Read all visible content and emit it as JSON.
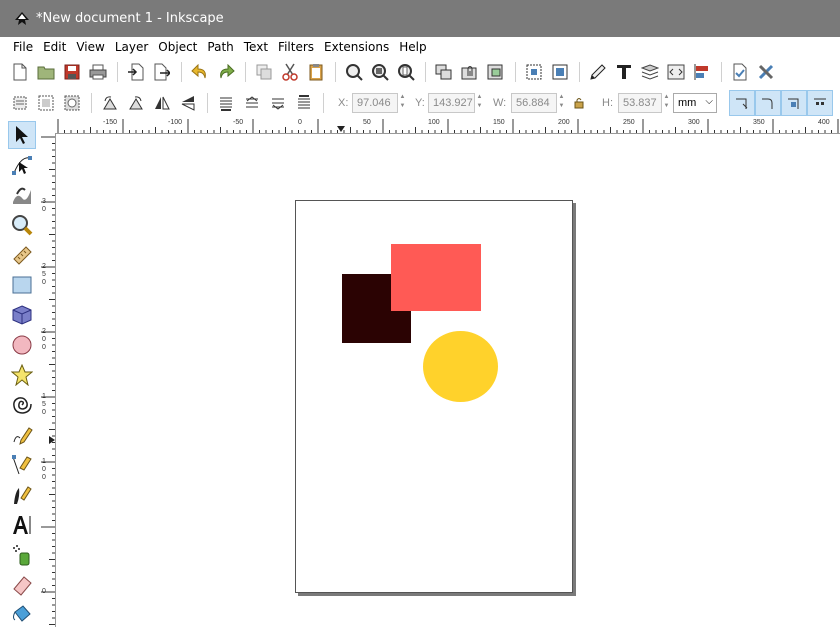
{
  "window": {
    "title": "*New document 1 - Inkscape"
  },
  "menu": [
    {
      "label": "File"
    },
    {
      "label": "Edit"
    },
    {
      "label": "View"
    },
    {
      "label": "Layer"
    },
    {
      "label": "Object"
    },
    {
      "label": "Path"
    },
    {
      "label": "Text"
    },
    {
      "label": "Filters"
    },
    {
      "label": "Extensions"
    },
    {
      "label": "Help"
    }
  ],
  "selection": {
    "x_label": "X:",
    "x": "97.046",
    "y_label": "Y:",
    "y": "143.927",
    "w_label": "W:",
    "w": "56.884",
    "h_label": "H:",
    "h": "53.837",
    "unit": "mm"
  },
  "ruler_h": [
    "-150",
    "-100",
    "-50",
    "0",
    "50",
    "100",
    "150",
    "200",
    "250",
    "300",
    "350",
    "400"
  ],
  "ruler_v": [
    "3",
    "0",
    "2",
    "5",
    "0",
    "2",
    "0",
    "0",
    "1",
    "5",
    "0",
    "1",
    "0",
    "0",
    "0"
  ],
  "colors": {
    "dark_square": "#2b0303",
    "red_rect": "#ff5a55",
    "yellow_circle": "#ffd22b",
    "titlebar": "#7a7a7a",
    "active_tool": "#cfe5f7"
  }
}
